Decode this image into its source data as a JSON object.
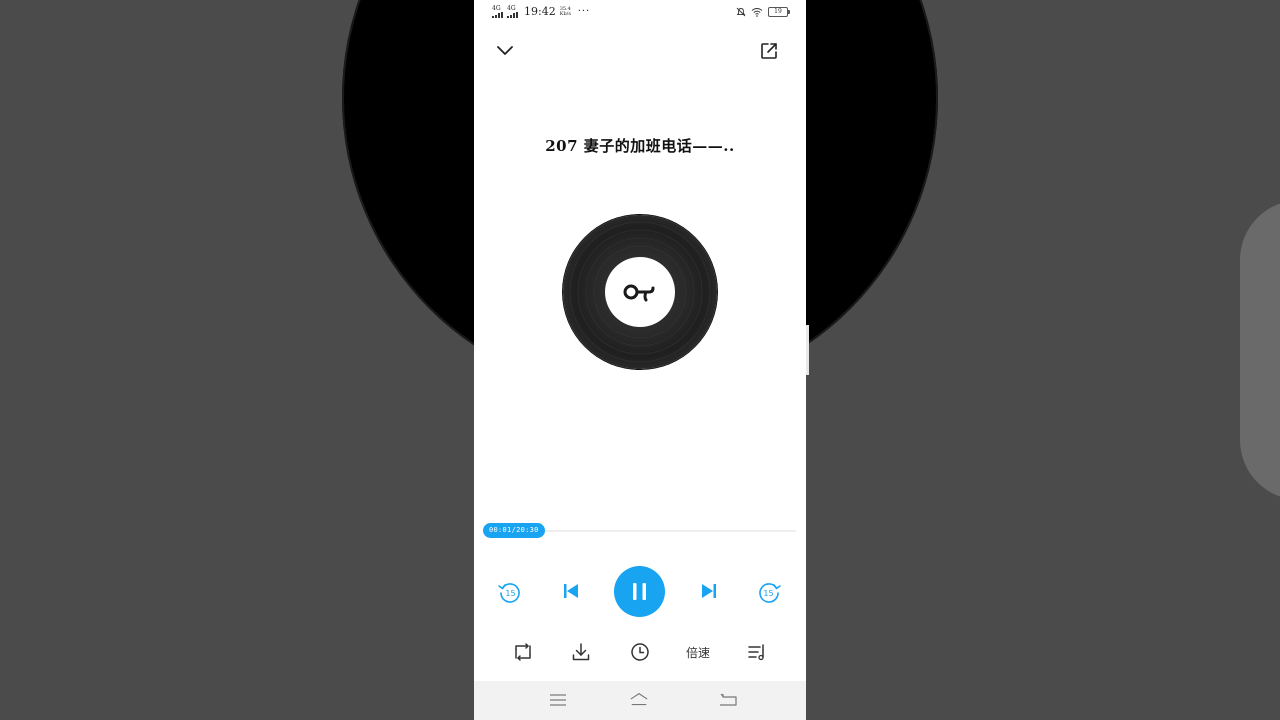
{
  "status_bar": {
    "network_1": "4G",
    "network_2": "4G",
    "time": "19:42",
    "net_speed": "35.4 Kb/s",
    "more": "···",
    "battery": "19"
  },
  "track": {
    "title": "207 妻子的加班电话——.."
  },
  "progress": {
    "time_label": "00:01/20:30",
    "fraction": 0.001
  },
  "controls": {
    "speed_label": "倍速"
  },
  "colors": {
    "accent": "#19a4f1",
    "disc": "#232323",
    "screen_bg": "#ffffff",
    "nav_bg": "#f2f2f2"
  },
  "icons": {
    "collapse": "chevron-down-icon",
    "share": "share-icon",
    "rewind": "rewind-15-icon",
    "prev": "skip-previous-icon",
    "play_pause": "pause-icon",
    "next": "skip-next-icon",
    "forward": "forward-15-icon",
    "loop": "loop-icon",
    "download": "download-icon",
    "timer": "clock-icon",
    "playlist": "playlist-icon"
  }
}
